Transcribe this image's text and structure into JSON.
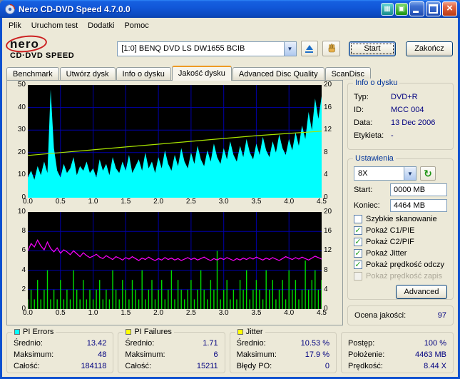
{
  "window": {
    "title": "Nero CD-DVD Speed 4.7.0.0"
  },
  "menu": {
    "items": [
      "Plik",
      "Uruchom test",
      "Dodatki",
      "Pomoc"
    ]
  },
  "logo": {
    "top": "nero",
    "bottom": "CD·DVD SPEED"
  },
  "header": {
    "drive": "[1:0]   BENQ DVD LS DW1655 BCIB",
    "start_label": "Start",
    "stop_label": "Zakończ"
  },
  "tabs": [
    {
      "label": "Benchmark",
      "active": false
    },
    {
      "label": "Utwórz dysk",
      "active": false
    },
    {
      "label": "Info o dysku",
      "active": false
    },
    {
      "label": "Jakość dysku",
      "active": true
    },
    {
      "label": "Advanced Disc Quality",
      "active": false
    },
    {
      "label": "ScanDisc",
      "active": false
    }
  ],
  "info_panel": {
    "title": "Info o dysku",
    "rows": [
      {
        "label": "Typ:",
        "value": "DVD+R"
      },
      {
        "label": "ID:",
        "value": "MCC 004"
      },
      {
        "label": "Data:",
        "value": "13 Dec 2006"
      },
      {
        "label": "Etykieta:",
        "value": "-"
      }
    ]
  },
  "settings": {
    "title": "Ustawienia",
    "speed": "8X",
    "start_label": "Start:",
    "start_value": "0000 MB",
    "end_label": "Koniec:",
    "end_value": "4464 MB",
    "checkboxes": [
      {
        "label": "Szybkie skanowanie",
        "checked": false,
        "disabled": false
      },
      {
        "label": "Pokaż C1/PIE",
        "checked": true,
        "disabled": false
      },
      {
        "label": "Pokaż C2/PIF",
        "checked": true,
        "disabled": false
      },
      {
        "label": "Pokaż Jitter",
        "checked": true,
        "disabled": false
      },
      {
        "label": "Pokaż prędkość odczy",
        "checked": true,
        "disabled": false
      },
      {
        "label": "Pokaż prędkość zapis",
        "checked": false,
        "disabled": true
      }
    ],
    "advanced_label": "Advanced"
  },
  "quality": {
    "label": "Ocena jakości:",
    "value": "97"
  },
  "stats": [
    {
      "title": "PI Errors",
      "legend": "#00FFFF",
      "rows": [
        {
          "label": "Średnio:",
          "value": "13.42"
        },
        {
          "label": "Maksimum:",
          "value": "48"
        },
        {
          "label": "Całość:",
          "value": "184118"
        }
      ]
    },
    {
      "title": "PI Failures",
      "legend": "#FFFF00",
      "rows": [
        {
          "label": "Średnio:",
          "value": "1.71"
        },
        {
          "label": "Maksimum:",
          "value": "6"
        },
        {
          "label": "Całość:",
          "value": "15211"
        }
      ]
    },
    {
      "title": "Jitter",
      "legend": "#FFFF00",
      "rows": [
        {
          "label": "Średnio:",
          "value": "10.53 %"
        },
        {
          "label": "Maksimum:",
          "value": "17.9 %"
        },
        {
          "label": "Błędy PO:",
          "value": "0"
        }
      ]
    }
  ],
  "progress": {
    "rows": [
      {
        "label": "Postęp:",
        "value": "100 %"
      },
      {
        "label": "Położenie:",
        "value": "4463 MB"
      },
      {
        "label": "Prędkość:",
        "value": "8.44 X"
      }
    ]
  },
  "chart_data": [
    {
      "type": "area",
      "title": "PI Errors vs position (GB) with read speed line",
      "bg": "#000000",
      "grid_color": "#0000AA",
      "x_ticks": [
        "0.0",
        "0.5",
        "1.0",
        "1.5",
        "2.0",
        "2.5",
        "3.0",
        "3.5",
        "4.0",
        "4.5"
      ],
      "left_ticks": [
        "50",
        "40",
        "30",
        "20",
        "10",
        "0"
      ],
      "right_ticks": [
        "20",
        "16",
        "12",
        "8",
        "4",
        "0"
      ],
      "left_max": 50,
      "right_max": 20,
      "series": [
        {
          "name": "PI Errors",
          "kind": "area",
          "axis": "left",
          "color": "#00FFFF",
          "values": [
            9,
            12,
            8,
            14,
            10,
            16,
            11,
            48,
            22,
            12,
            9,
            15,
            11,
            13,
            18,
            10,
            14,
            12,
            16,
            11,
            13,
            9,
            17,
            12,
            15,
            10,
            18,
            13,
            11,
            16,
            12,
            19,
            11,
            14,
            17,
            12,
            20,
            13,
            16,
            11,
            18,
            13,
            21,
            15,
            12,
            19,
            14,
            22,
            16,
            13,
            20,
            15,
            23,
            17,
            14,
            21,
            16,
            24,
            18,
            15,
            22,
            17,
            25,
            19,
            16,
            23,
            18,
            26,
            20,
            17,
            24,
            19,
            27,
            21,
            18,
            25,
            20,
            28,
            22,
            19,
            26,
            21,
            29,
            23,
            32,
            26,
            38,
            30,
            44,
            35,
            45
          ]
        },
        {
          "name": "Prędkość odczytu",
          "kind": "line",
          "axis": "right",
          "color": "#A8E400",
          "values": [
            7.5,
            8.0,
            8.5,
            9.0,
            9.5,
            10.0,
            10.5,
            11.0,
            11.4,
            11.8
          ]
        }
      ]
    },
    {
      "type": "bar",
      "title": "PI Failures (bars) and Jitter % (line) vs position (GB)",
      "bg": "#000000",
      "grid_color": "#0000AA",
      "x_ticks": [
        "0.0",
        "0.5",
        "1.0",
        "1.5",
        "2.0",
        "2.5",
        "3.0",
        "3.5",
        "4.0",
        "4.5"
      ],
      "left_ticks": [
        "10",
        "8",
        "6",
        "4",
        "2",
        "0"
      ],
      "right_ticks": [
        "20",
        "16",
        "12",
        "8",
        "4",
        "0"
      ],
      "left_max": 10,
      "right_max": 20,
      "series": [
        {
          "name": "PI Failures",
          "kind": "bars",
          "axis": "left",
          "color": "#00DD00",
          "values": [
            1,
            2,
            1,
            3,
            1,
            2,
            4,
            1,
            2,
            1,
            3,
            1,
            2,
            1,
            4,
            2,
            1,
            3,
            1,
            2,
            1,
            2,
            3,
            1,
            2,
            1,
            4,
            2,
            1,
            3,
            2,
            1,
            3,
            2,
            1,
            4,
            1,
            2,
            3,
            1,
            2,
            3,
            1,
            2,
            4,
            1,
            3,
            2,
            1,
            2,
            3,
            1,
            2,
            4,
            2,
            1,
            3,
            2,
            6,
            1,
            2,
            3,
            1,
            2,
            1,
            3,
            2,
            4,
            1,
            2,
            3,
            2,
            1,
            4,
            2,
            3,
            1,
            2,
            3,
            1,
            4,
            2,
            3,
            1,
            2,
            5,
            2,
            3,
            4,
            2,
            3
          ]
        },
        {
          "name": "Jitter",
          "kind": "line",
          "axis": "right",
          "color": "#FF00FF",
          "values": [
            12.0,
            13.5,
            12.8,
            14.2,
            13.0,
            12.2,
            13.8,
            12.5,
            11.8,
            12.6,
            11.5,
            12.2,
            11.8,
            11.2,
            12.0,
            11.4,
            10.8,
            11.6,
            11.0,
            10.6,
            10.9,
            11.3,
            10.7,
            10.4,
            11.0,
            10.6,
            10.2,
            10.8,
            10.5,
            10.1,
            10.6,
            10.3,
            10.8,
            10.4,
            10.0,
            10.5,
            10.2,
            10.7,
            10.3,
            10.0,
            10.4,
            10.1,
            10.6,
            10.2,
            10.5,
            10.1,
            10.4,
            10.0,
            10.3,
            10.6,
            10.2,
            10.5,
            10.1,
            10.4,
            10.7,
            10.3,
            10.0,
            10.4,
            10.1,
            10.5,
            10.2,
            10.6,
            10.3,
            10.0,
            10.4,
            10.1,
            10.5,
            10.2,
            10.6,
            10.3,
            10.7,
            10.4,
            10.1,
            10.5,
            10.2,
            10.6,
            10.3,
            10.0,
            10.4,
            10.8,
            10.5,
            10.2,
            10.6,
            10.3,
            10.7,
            10.4,
            10.1,
            10.5,
            10.9,
            10.6,
            10.3
          ]
        }
      ]
    }
  ]
}
